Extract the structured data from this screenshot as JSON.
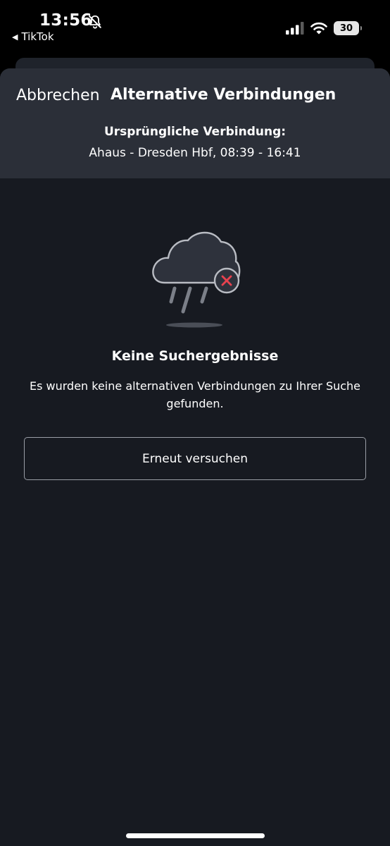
{
  "status_bar": {
    "time": "13:56",
    "back_app": "TikTok",
    "battery": "30",
    "icons": [
      "bell-slash-icon",
      "signal-icon",
      "wifi-icon",
      "battery-icon"
    ]
  },
  "header": {
    "cancel_label": "Abbrechen",
    "title": "Alternative Verbindungen",
    "original_label": "Ursprüngliche Verbindung:",
    "original_value": "Ahaus - Dresden Hbf, 08:39 - 16:41"
  },
  "empty_state": {
    "icon": "rain-cloud-error-icon",
    "title": "Keine Suchergebnisse",
    "description": "Es wurden keine alternativen Verbindungen zu Ihrer Suche gefunden.",
    "retry_label": "Erneut versuchen"
  },
  "colors": {
    "background": "#171a21",
    "header_background": "#2b2f38",
    "error_accent": "#e8424f"
  }
}
